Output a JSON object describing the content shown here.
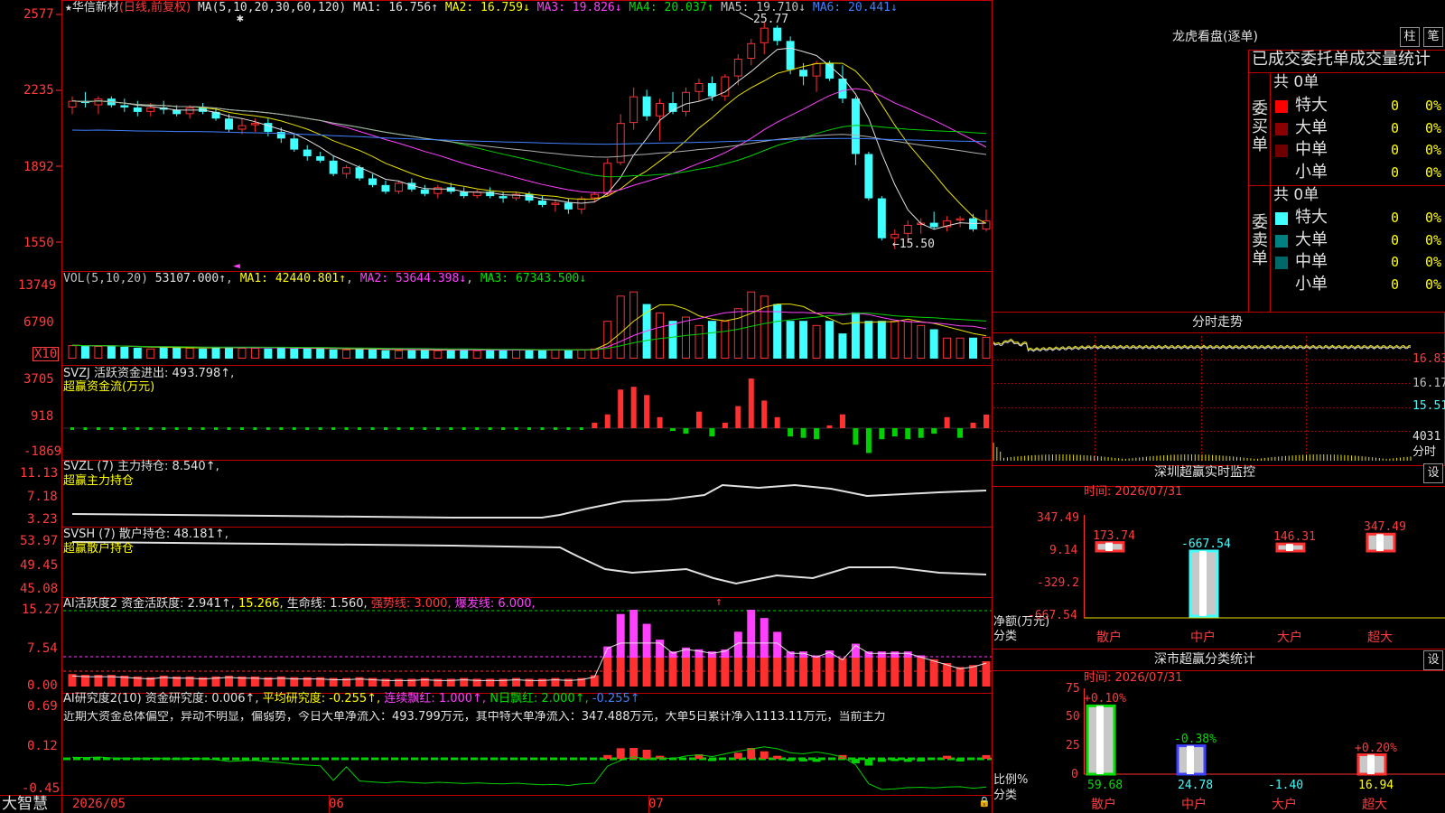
{
  "stock": {
    "star": "★",
    "name": "华信新材",
    "mode": "(日线,前复权)"
  },
  "ma_legend": {
    "head": "MA(5,10,20,30,60,120)",
    "items": [
      {
        "label": "MA1:",
        "value": "16.756↑",
        "color": "#e0e0e0"
      },
      {
        "label": "MA2:",
        "value": "16.759↓",
        "color": "#ffff00"
      },
      {
        "label": "MA3:",
        "value": "19.826↓",
        "color": "#ff40ff"
      },
      {
        "label": "MA4:",
        "value": "20.037↑",
        "color": "#00e000"
      },
      {
        "label": "MA5:",
        "value": "19.710↓",
        "color": "#c0c0c0"
      },
      {
        "label": "MA6:",
        "value": "20.441↓",
        "color": "#4080ff"
      }
    ]
  },
  "price_axis": [
    "2577",
    "2235",
    "1892",
    "1550"
  ],
  "annotations": {
    "high": "25.77",
    "low": "←15.50",
    "star_mark": "✱",
    "zero_marker": "◄"
  },
  "vol": {
    "title": "VOL(5,10,20)",
    "value": "53107.000↑",
    "ma1": "MA1: 42440.801↑",
    "ma2": "MA2: 53644.398↓",
    "ma3": "MA3: 67343.500↓",
    "axis": [
      "13749",
      "6790"
    ],
    "x10": "X10"
  },
  "svzj": {
    "title": "SVZJ  活跃资金进出: 493.798↑,",
    "sub": "超赢资金流(万元)",
    "axis": [
      "3705",
      "918",
      "-1869"
    ]
  },
  "svzl": {
    "title": "SVZL (7) 主力持仓: 8.540↑,",
    "sub": "超赢主力持仓",
    "axis": [
      "11.13",
      "7.18",
      "3.23"
    ]
  },
  "svsh": {
    "title": "SVSH (7) 散户持仓: 48.181↑,",
    "sub": "超赢散户持仓",
    "axis": [
      "53.97",
      "49.45",
      "45.08"
    ]
  },
  "ai1": {
    "title": "AI活跃度2 资金活跃度: 2.941↑,",
    "v2": "15.266,",
    "life": "生命线: 1.560,",
    "strong": "强势线: 3.000,",
    "burst": "爆发线: 6.000,",
    "axis": [
      "15.27",
      "7.54",
      "0.00"
    ],
    "arrow": "↑"
  },
  "ai2": {
    "title": "AI研究度2(10) 资金研究度: 0.006↑,",
    "avg": "平均研究度: -0.255↑,",
    "cont": "连续飘红: 1.000↑,",
    "nday": "N日飘红: 2.000↑,",
    "last": "-0.255↑",
    "text": "近期大资金总体偏空，异动不明显，偏弱势，今日大单净流入：493.799万元，其中特大单净流入：347.488万元，大单5日累计净入1113.11万元，当前主力",
    "axis": [
      "0.69",
      "0.12",
      "-0.45"
    ]
  },
  "date_axis": [
    "2026/05",
    "06",
    "07"
  ],
  "brand": "大智慧",
  "right": {
    "lhb_title": "龙虎看盘(逐单)",
    "buttons": [
      "柱",
      "笔"
    ],
    "stats_header": "已成交委托单成交量统计",
    "buy_group": {
      "label": "委买单",
      "total": "共 0单",
      "rows": [
        {
          "name": "特大",
          "count": "0",
          "pct": "0%",
          "color": "#ff0000"
        },
        {
          "name": "大单",
          "count": "0",
          "pct": "0%",
          "color": "#8b0000"
        },
        {
          "name": "中单",
          "count": "0",
          "pct": "0%",
          "color": "#700000"
        },
        {
          "name": "小单",
          "count": "0",
          "pct": "0%",
          "color": "#000000"
        }
      ]
    },
    "sell_group": {
      "label": "委卖单",
      "total": "共 0单",
      "rows": [
        {
          "name": "特大",
          "count": "0",
          "pct": "0%",
          "color": "#40ffff"
        },
        {
          "name": "大单",
          "count": "0",
          "pct": "0%",
          "color": "#008080"
        },
        {
          "name": "中单",
          "count": "0",
          "pct": "0%",
          "color": "#006868"
        },
        {
          "name": "小单",
          "count": "0",
          "pct": "0%",
          "color": "#000000"
        }
      ]
    },
    "intraday": {
      "title": "分时走势",
      "prices": [
        "16.83",
        "16.17",
        "15.51"
      ],
      "vol": "4031",
      "vol_label": "分时"
    },
    "monitor": {
      "title": "深圳超赢实时监控",
      "set": "设",
      "date": "时间: 2026/07/31",
      "axis": [
        "347.49",
        "9.14",
        "-329.2",
        "-667.54"
      ],
      "ylabel": "净额(万元)",
      "xlabel": "分类",
      "bars": [
        {
          "cat": "散户",
          "value": 173.74,
          "label": "173.74"
        },
        {
          "cat": "中户",
          "value": -667.54,
          "label": "-667.54"
        },
        {
          "cat": "大户",
          "value": 146.31,
          "label": "146.31"
        },
        {
          "cat": "超大",
          "value": 347.49,
          "label": "347.49"
        }
      ]
    },
    "classify": {
      "title": "深市超赢分类统计",
      "set": "设",
      "date": "时间: 2026/07/31",
      "axis": [
        "75",
        "50",
        "25",
        "0"
      ],
      "ylabel": "比例%",
      "xlabel": "分类",
      "bars": [
        {
          "cat": "散户",
          "value": 59.68,
          "change": "+0.10%",
          "label": "59.68",
          "color": "#00e000"
        },
        {
          "cat": "中户",
          "value": 24.78,
          "change": "-0.38%",
          "label": "24.78",
          "color": "#4040ff"
        },
        {
          "cat": "大户",
          "value": -1.4,
          "change": "",
          "label": "-1.40",
          "color": "#40ffff"
        },
        {
          "cat": "超大",
          "value": 16.94,
          "change": "+0.20%",
          "label": "16.94",
          "color": "#ff3030"
        }
      ]
    }
  },
  "chart_data": {
    "type": "candlestick",
    "title": "华信新材",
    "x_range": [
      "2026/05",
      "2026/07/31"
    ],
    "ylim": [
      15.5,
      25.77
    ],
    "ohlc": [
      [
        21.9,
        22.4,
        21.6,
        22.2
      ],
      [
        22.2,
        22.6,
        21.9,
        22.1
      ],
      [
        22.0,
        22.4,
        21.6,
        22.3
      ],
      [
        22.3,
        22.4,
        21.9,
        22.0
      ],
      [
        22.0,
        22.3,
        21.7,
        21.9
      ],
      [
        21.9,
        22.2,
        21.5,
        21.7
      ],
      [
        21.7,
        22.1,
        21.5,
        21.9
      ],
      [
        21.9,
        22.2,
        21.6,
        21.8
      ],
      [
        21.8,
        22.0,
        21.5,
        21.6
      ],
      [
        21.6,
        22.0,
        21.4,
        21.9
      ],
      [
        21.9,
        22.1,
        21.6,
        21.7
      ],
      [
        21.7,
        21.9,
        21.3,
        21.4
      ],
      [
        21.4,
        21.6,
        20.8,
        20.9
      ],
      [
        20.9,
        21.4,
        20.7,
        21.1
      ],
      [
        21.1,
        21.4,
        20.8,
        21.2
      ],
      [
        21.2,
        21.4,
        20.6,
        20.8
      ],
      [
        20.8,
        21.0,
        20.3,
        20.5
      ],
      [
        20.5,
        20.7,
        19.9,
        20.0
      ],
      [
        20.0,
        20.2,
        19.5,
        19.7
      ],
      [
        19.7,
        19.9,
        19.4,
        19.5
      ],
      [
        19.5,
        19.7,
        18.8,
        18.9
      ],
      [
        18.9,
        19.3,
        18.7,
        19.2
      ],
      [
        19.2,
        19.3,
        18.6,
        18.7
      ],
      [
        18.7,
        18.9,
        18.3,
        18.4
      ],
      [
        18.4,
        18.6,
        18.0,
        18.1
      ],
      [
        18.1,
        18.6,
        18.0,
        18.5
      ],
      [
        18.5,
        18.7,
        18.1,
        18.2
      ],
      [
        18.2,
        18.4,
        17.9,
        18.0
      ],
      [
        18.0,
        18.4,
        17.8,
        18.3
      ],
      [
        18.3,
        18.5,
        18.0,
        18.1
      ],
      [
        18.1,
        18.3,
        17.8,
        17.9
      ],
      [
        17.9,
        18.2,
        17.8,
        18.1
      ],
      [
        18.1,
        18.3,
        17.8,
        17.9
      ],
      [
        17.9,
        18.1,
        17.6,
        17.8
      ],
      [
        17.8,
        18.1,
        17.7,
        18.0
      ],
      [
        18.0,
        18.1,
        17.6,
        17.7
      ],
      [
        17.7,
        17.9,
        17.4,
        17.5
      ],
      [
        17.5,
        17.7,
        17.2,
        17.6
      ],
      [
        17.6,
        17.8,
        17.1,
        17.3
      ],
      [
        17.3,
        17.9,
        17.1,
        17.8
      ],
      [
        17.8,
        18.1,
        17.6,
        18.0
      ],
      [
        18.0,
        19.6,
        17.9,
        19.4
      ],
      [
        19.4,
        21.6,
        19.3,
        21.2
      ],
      [
        21.2,
        22.8,
        20.9,
        22.4
      ],
      [
        22.4,
        22.7,
        21.3,
        21.5
      ],
      [
        21.5,
        22.3,
        20.4,
        22.1
      ],
      [
        22.1,
        22.6,
        21.6,
        21.7
      ],
      [
        21.7,
        22.8,
        21.5,
        22.6
      ],
      [
        22.6,
        23.2,
        22.2,
        23.0
      ],
      [
        23.0,
        23.3,
        22.2,
        22.4
      ],
      [
        22.4,
        23.4,
        22.2,
        23.3
      ],
      [
        23.3,
        24.3,
        22.9,
        24.1
      ],
      [
        24.1,
        25.0,
        23.8,
        24.8
      ],
      [
        24.8,
        25.77,
        24.3,
        25.5
      ],
      [
        25.5,
        25.6,
        24.7,
        24.9
      ],
      [
        24.9,
        25.1,
        23.4,
        23.6
      ],
      [
        23.6,
        23.9,
        22.9,
        23.3
      ],
      [
        23.3,
        24.0,
        22.6,
        23.9
      ],
      [
        23.9,
        24.0,
        23.1,
        23.2
      ],
      [
        23.2,
        23.8,
        22.1,
        22.3
      ],
      [
        22.3,
        22.4,
        19.3,
        19.8
      ],
      [
        19.8,
        19.9,
        17.7,
        17.8
      ],
      [
        17.8,
        17.9,
        15.9,
        16.0
      ],
      [
        16.0,
        16.4,
        15.5,
        16.2
      ],
      [
        16.2,
        16.8,
        15.8,
        16.6
      ],
      [
        16.6,
        16.9,
        16.2,
        16.7
      ],
      [
        16.7,
        17.2,
        16.4,
        16.5
      ],
      [
        16.5,
        17.0,
        16.3,
        16.8
      ],
      [
        16.8,
        17.0,
        16.5,
        16.9
      ],
      [
        16.9,
        17.1,
        16.3,
        16.4
      ],
      [
        16.4,
        17.3,
        16.3,
        16.8
      ]
    ],
    "volume": [
      1.6,
      1.5,
      1.5,
      1.5,
      1.4,
      1.3,
      1.2,
      1.4,
      1.3,
      1.3,
      1.2,
      1.3,
      1.4,
      1.3,
      1.3,
      1.2,
      1.3,
      1.2,
      1.2,
      1.2,
      1.1,
      1.1,
      1.2,
      1.1,
      1.0,
      1.0,
      1.0,
      1.1,
      1.0,
      1.0,
      1.1,
      1.0,
      1.0,
      1.0,
      1.1,
      1.0,
      1.0,
      1.1,
      1.0,
      1.1,
      1.2,
      4.5,
      7.5,
      8.0,
      6.5,
      5.5,
      4.5,
      5.0,
      4.0,
      4.5,
      4.5,
      6.0,
      8.0,
      7.5,
      6.5,
      4.5,
      4.5,
      4.0,
      4.5,
      3.0,
      5.5,
      4.5,
      4.5,
      4.5,
      4.5,
      4.0,
      3.5,
      2.5,
      2.5,
      2.5,
      2.6
    ],
    "svzj": [
      -50,
      -60,
      -40,
      -45,
      -40,
      -55,
      -50,
      -40,
      -60,
      -45,
      -50,
      -40,
      -60,
      -50,
      -45,
      -50,
      -60,
      -40,
      -55,
      -40,
      -50,
      -60,
      -45,
      -50,
      -40,
      -55,
      -50,
      -45,
      -40,
      -50,
      -45,
      -40,
      -50,
      -40,
      -30,
      -50,
      -40,
      -50,
      -30,
      -20,
      200,
      500,
      1400,
      1500,
      1200,
      400,
      -100,
      -200,
      600,
      -300,
      200,
      800,
      1800,
      1000,
      400,
      -300,
      -350,
      -400,
      100,
      500,
      -600,
      -900,
      -400,
      -300,
      -400,
      -350,
      -200,
      400,
      -350,
      200,
      493.8
    ]
  }
}
